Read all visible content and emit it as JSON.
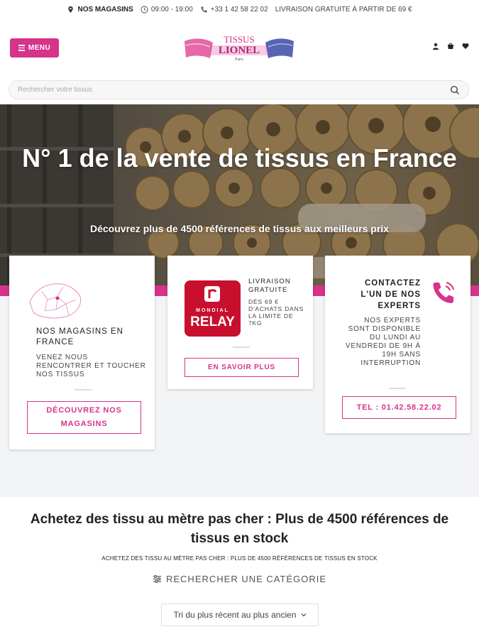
{
  "topbar": {
    "stores": "NOS MAGASINS",
    "hours": "09:00 - 19:00",
    "phone": "+33 1 42 58 22 02",
    "shipping": "LIVRAISON GRATUITE À PARTIR DE 69 €"
  },
  "header": {
    "menu_label": "MENU",
    "logo_line1": "TISSUS",
    "logo_line2": "LIONEL",
    "logo_line3": "Paris",
    "icons": [
      "user-icon",
      "cart-icon",
      "heart-icon"
    ]
  },
  "search": {
    "placeholder": "Rechercher votre tissus"
  },
  "hero": {
    "title": "N° 1 de la vente de tissus en France",
    "subtitle": "Découvrez plus de 4500 références de tissus aux meilleurs prix"
  },
  "cards": {
    "stores": {
      "title": "NOS MAGASINS EN FRANCE",
      "desc": "VENEZ NOUS RENCONTRER ET TOUCHER NOS TISSUS",
      "button": "DÉCOUVREZ NOS MAGASINS"
    },
    "delivery": {
      "logo_top": "MONDIAL",
      "logo_bottom": "RELAY",
      "title": "LIVRAISON GRATUITE",
      "desc": "DÈS 69 € D'ACHATS DANS LA LIMITE DE 7KG",
      "button": "EN SAVOIR PLUS"
    },
    "contact": {
      "title": "CONTACTEZ L'UN DE NOS EXPERTS",
      "desc": "NOS EXPERTS SONT DISPONIBLE DU LUNDI AU VENDREDI DE 9H À 19H SANS INTERRUPTION",
      "button": "TEL : 01.42.58.22.02"
    }
  },
  "content": {
    "title": "Achetez des tissu au mètre pas cher : Plus de 4500 références de tissus en stock",
    "subtitle": "ACHETEZ DES TISSU AU MÈTRE PAS CHER : PLUS DE 4500 RÉFÉRENCES DE TISSUS EN STOCK",
    "category_search": "RECHERCHER UNE CATÉGORIE",
    "sort_selected": "Tri du plus récent au plus ancien"
  },
  "colors": {
    "accent": "#d6338b",
    "relay_red": "#c8102e"
  }
}
